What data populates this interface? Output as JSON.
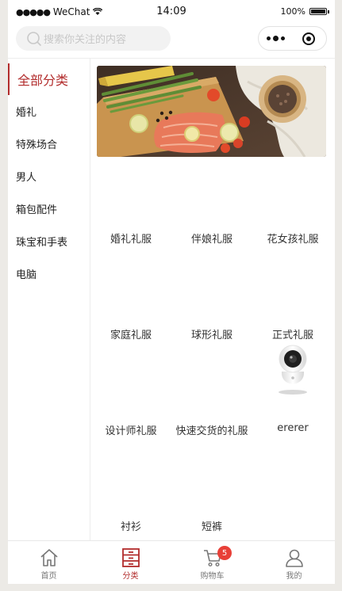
{
  "status_bar": {
    "carrier": "WeChat",
    "time": "14:09",
    "battery": "100%"
  },
  "search": {
    "placeholder": "搜索你关注的内容"
  },
  "sidebar": {
    "items": [
      {
        "label": "全部分类",
        "active": true
      },
      {
        "label": "婚礼"
      },
      {
        "label": "特殊场合"
      },
      {
        "label": "男人"
      },
      {
        "label": "箱包配件"
      },
      {
        "label": "珠宝和手表"
      },
      {
        "label": "电脑"
      }
    ]
  },
  "categories": [
    {
      "label": "婚礼礼服"
    },
    {
      "label": "伴娘礼服"
    },
    {
      "label": "花女孩礼服"
    },
    {
      "label": "家庭礼服"
    },
    {
      "label": "球形礼服"
    },
    {
      "label": "正式礼服"
    },
    {
      "label": "设计师礼服"
    },
    {
      "label": "快速交货的礼服"
    },
    {
      "label": "ererer",
      "image": "camera"
    },
    {
      "label": "衬衫"
    },
    {
      "label": "短裤"
    }
  ],
  "tabbar": {
    "items": [
      {
        "label": "首页",
        "icon": "home-icon"
      },
      {
        "label": "分类",
        "icon": "category-icon",
        "active": true
      },
      {
        "label": "购物车",
        "icon": "cart-icon",
        "badge": "5"
      },
      {
        "label": "我的",
        "icon": "user-icon"
      }
    ]
  },
  "colors": {
    "accent": "#b22c2c",
    "badge": "#e84038"
  }
}
